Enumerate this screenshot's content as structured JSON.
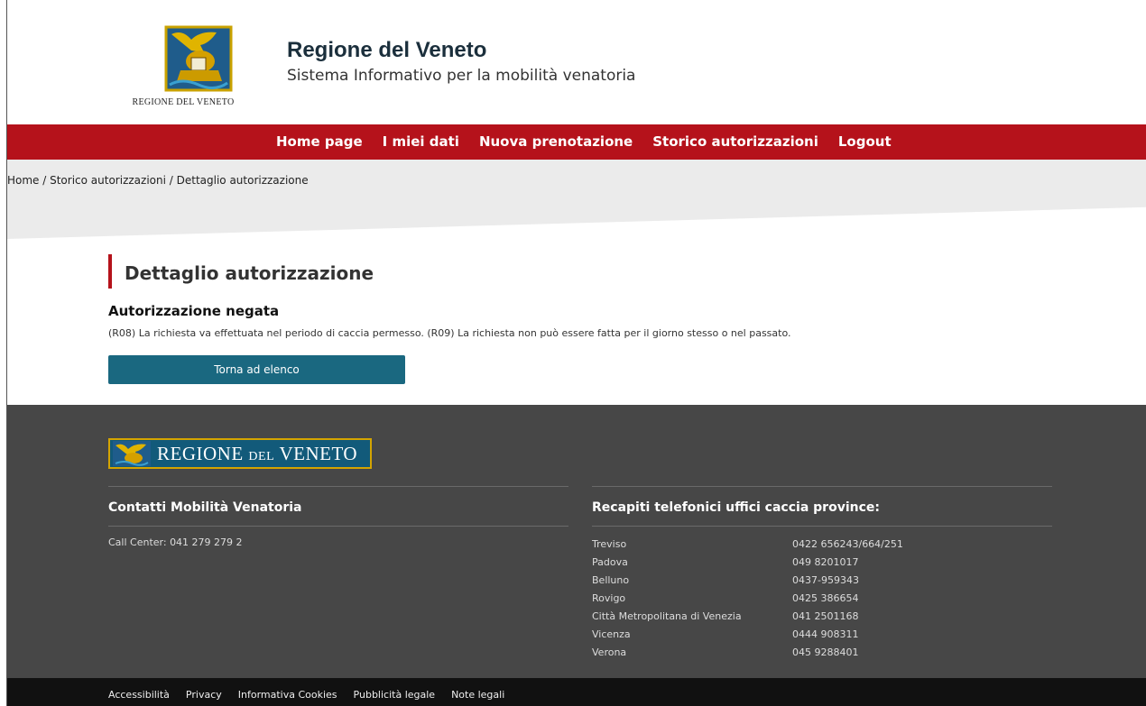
{
  "header": {
    "logo_caption_main": "REGIONE DEL VENETO",
    "title": "Regione del Veneto",
    "subtitle": "Sistema Informativo per la mobilità venatoria"
  },
  "nav": {
    "items": [
      "Home page",
      "I miei dati",
      "Nuova prenotazione",
      "Storico autorizzazioni",
      "Logout"
    ]
  },
  "breadcrumb": {
    "items": [
      "Home",
      "Storico autorizzazioni",
      "Dettaglio autorizzazione"
    ],
    "separator": " / "
  },
  "main": {
    "page_title": "Dettaglio autorizzazione",
    "status_title": "Autorizzazione negata",
    "status_message": "(R08) La richiesta va effettuata nel periodo di caccia permesso. (R09) La richiesta non può essere fatta per il giorno stesso o nel passato.",
    "back_button_label": "Torna ad elenco"
  },
  "footer": {
    "logo_text_1": "REGIONE",
    "logo_text_2": "DEL",
    "logo_text_3": "VENETO",
    "contacts_title": "Contatti Mobilità Venatoria",
    "call_center": "Call Center: 041 279 279 2",
    "phones_title": "Recapiti telefonici uffici caccia province:",
    "phones": [
      {
        "province": "Treviso",
        "number": "0422 656243/664/251"
      },
      {
        "province": "Padova",
        "number": "049 8201017"
      },
      {
        "province": "Belluno",
        "number": "0437-959343"
      },
      {
        "province": "Rovigo",
        "number": "0425 386654"
      },
      {
        "province": "Città Metropolitana di Venezia",
        "number": "041 2501168"
      },
      {
        "province": "Vicenza",
        "number": "0444 908311"
      },
      {
        "province": "Verona",
        "number": "045 9288401"
      }
    ]
  },
  "bottom_links": [
    "Accessibilità",
    "Privacy",
    "Informativa Cookies",
    "Pubblicità legale",
    "Note legali"
  ],
  "colors": {
    "brand_red": "#b5121b",
    "button_teal": "#1a6880",
    "footer_gray": "#474747"
  }
}
